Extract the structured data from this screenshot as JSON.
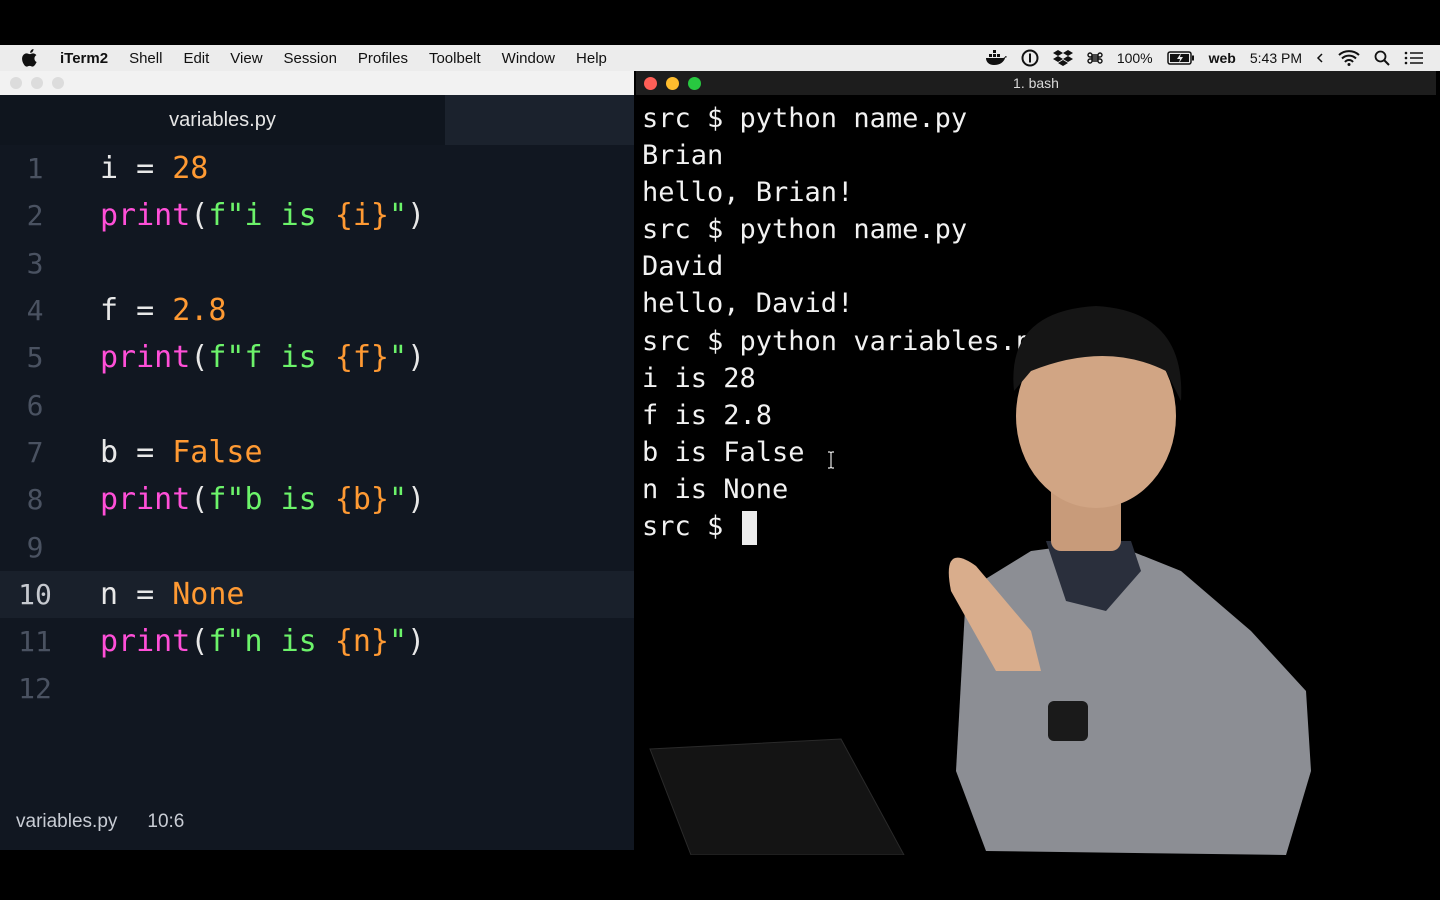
{
  "menubar": {
    "app_name": "iTerm2",
    "items": [
      "Shell",
      "Edit",
      "View",
      "Session",
      "Profiles",
      "Toolbelt",
      "Window",
      "Help"
    ],
    "battery": "100%",
    "user": "web",
    "time": "5:43 PM"
  },
  "editor": {
    "tab_title": "variables.py",
    "lines": [
      {
        "num": "1",
        "tokens": [
          [
            "plain",
            "i = "
          ],
          [
            "num",
            "28"
          ]
        ]
      },
      {
        "num": "2",
        "tokens": [
          [
            "func",
            "print"
          ],
          [
            "plain",
            "("
          ],
          [
            "str",
            "f\"i is "
          ],
          [
            "brace",
            "{i}"
          ],
          [
            "str",
            "\""
          ],
          [
            "plain",
            ")"
          ]
        ]
      },
      {
        "num": "3",
        "tokens": []
      },
      {
        "num": "4",
        "tokens": [
          [
            "plain",
            "f = "
          ],
          [
            "num",
            "2.8"
          ]
        ]
      },
      {
        "num": "5",
        "tokens": [
          [
            "func",
            "print"
          ],
          [
            "plain",
            "("
          ],
          [
            "str",
            "f\"f is "
          ],
          [
            "brace",
            "{f}"
          ],
          [
            "str",
            "\""
          ],
          [
            "plain",
            ")"
          ]
        ]
      },
      {
        "num": "6",
        "tokens": []
      },
      {
        "num": "7",
        "tokens": [
          [
            "plain",
            "b = "
          ],
          [
            "num",
            "False"
          ]
        ]
      },
      {
        "num": "8",
        "tokens": [
          [
            "func",
            "print"
          ],
          [
            "plain",
            "("
          ],
          [
            "str",
            "f\"b is "
          ],
          [
            "brace",
            "{b}"
          ],
          [
            "str",
            "\""
          ],
          [
            "plain",
            ")"
          ]
        ]
      },
      {
        "num": "9",
        "tokens": []
      },
      {
        "num": "10",
        "tokens": [
          [
            "plain",
            "n = "
          ],
          [
            "num",
            "None"
          ]
        ],
        "current": true
      },
      {
        "num": "11",
        "tokens": [
          [
            "func",
            "print"
          ],
          [
            "plain",
            "("
          ],
          [
            "str",
            "f\"n is "
          ],
          [
            "brace",
            "{n}"
          ],
          [
            "str",
            "\""
          ],
          [
            "plain",
            ")"
          ]
        ]
      },
      {
        "num": "12",
        "tokens": []
      }
    ],
    "status": {
      "file": "variables.py",
      "position": "10:6"
    }
  },
  "terminal": {
    "title": "1. bash",
    "lines": [
      "src $ python name.py",
      "Brian",
      "hello, Brian!",
      "src $ python name.py",
      "David",
      "hello, David!",
      "src $ python variables.py",
      "i is 28",
      "f is 2.8",
      "b is False",
      "n is None"
    ],
    "prompt": "src $ "
  },
  "colors": {
    "editor_bg": "#111721",
    "number": "#ff9a33",
    "function": "#ff4fd8",
    "string": "#6cf36a",
    "terminal_bg": "#000000"
  }
}
